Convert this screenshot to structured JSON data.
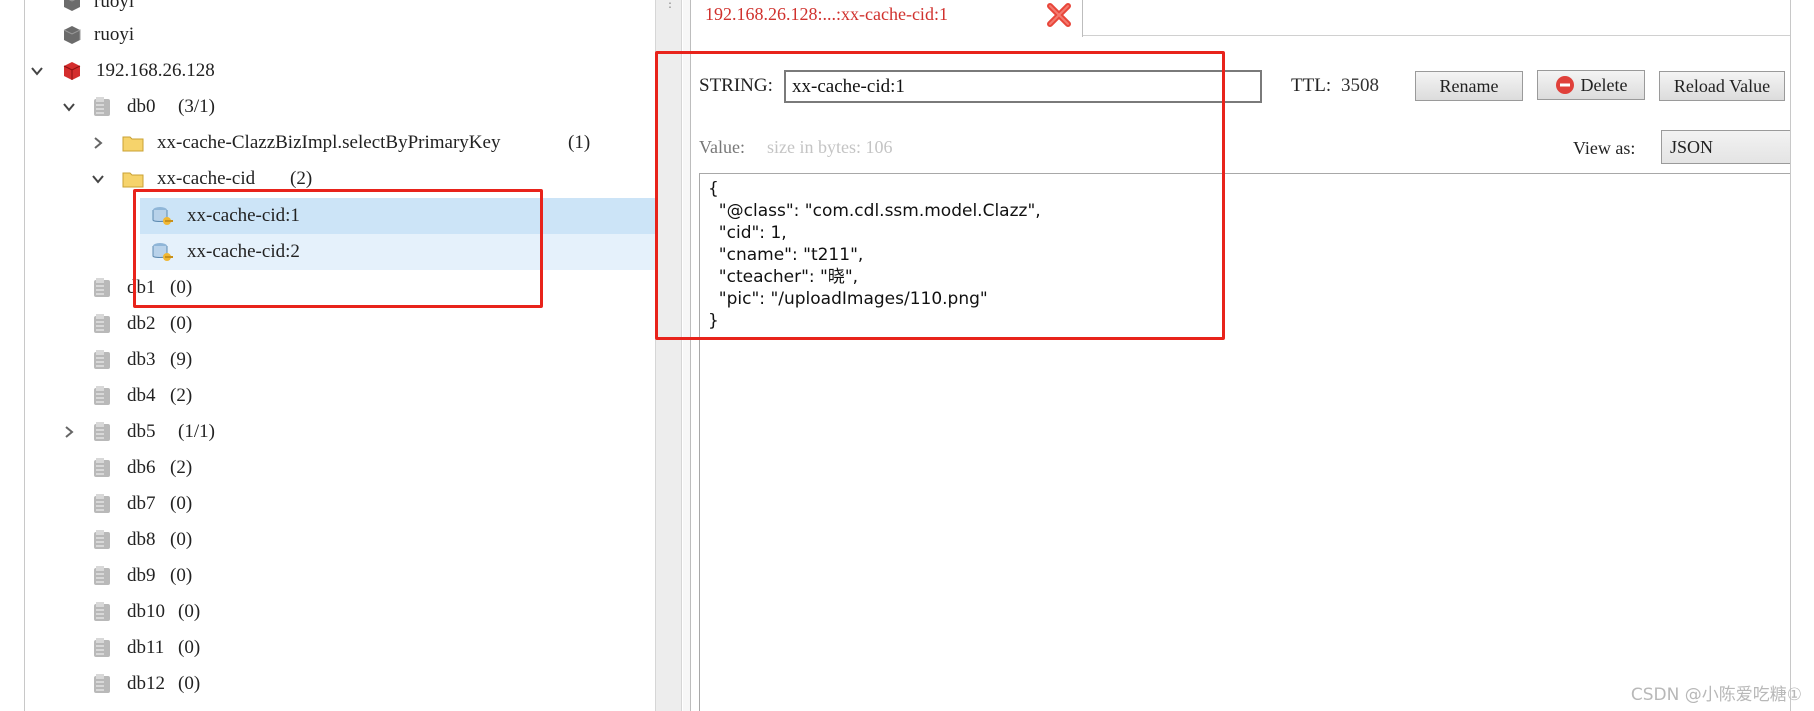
{
  "tree": {
    "partial_top": "ruoyi",
    "items": [
      {
        "label": "ruoyi",
        "count": ""
      },
      {
        "label": "192.168.26.128",
        "count": ""
      },
      {
        "label": "db0",
        "count": "(3/1)"
      },
      {
        "label": "xx-cache-ClazzBizImpl.selectByPrimaryKey",
        "count": "(1)"
      },
      {
        "label": "xx-cache-cid",
        "count": "(2)"
      },
      {
        "label": "xx-cache-cid:1",
        "count": ""
      },
      {
        "label": "xx-cache-cid:2",
        "count": ""
      },
      {
        "label": "db1",
        "count": "(0)"
      },
      {
        "label": "db2",
        "count": "(0)"
      },
      {
        "label": "db3",
        "count": "(9)"
      },
      {
        "label": "db4",
        "count": "(2)"
      },
      {
        "label": "db5",
        "count": "(1/1)"
      },
      {
        "label": "db6",
        "count": "(2)"
      },
      {
        "label": "db7",
        "count": "(0)"
      },
      {
        "label": "db8",
        "count": "(0)"
      },
      {
        "label": "db9",
        "count": "(0)"
      },
      {
        "label": "db10",
        "count": "(0)"
      },
      {
        "label": "db11",
        "count": "(0)"
      },
      {
        "label": "db12",
        "count": "(0)"
      }
    ]
  },
  "tab": {
    "title": "192.168.26.128:...:xx-cache-cid:1"
  },
  "editor": {
    "type_label": "STRING:",
    "key_value": "xx-cache-cid:1",
    "ttl_label": "TTL:",
    "ttl_value": "3508",
    "rename_label": "Rename",
    "delete_label": "Delete",
    "reload_label": "Reload Value",
    "value_label": "Value:",
    "size_hint": "size in bytes: 106",
    "view_as_label": "View as:",
    "view_as_value": "JSON",
    "value_text": "{\n  \"@class\": \"com.cdl.ssm.model.Clazz\",\n  \"cid\": 1,\n  \"cname\": \"t211\",\n  \"cteacher\": \"晓\",\n  \"pic\": \"/uploadImages/110.png\"\n}"
  },
  "watermark": "CSDN @小陈爱吃糖①",
  "colors": {
    "accent_red": "#e8231b",
    "tab_text": "#d0312d",
    "selection": "#cce4f7"
  }
}
